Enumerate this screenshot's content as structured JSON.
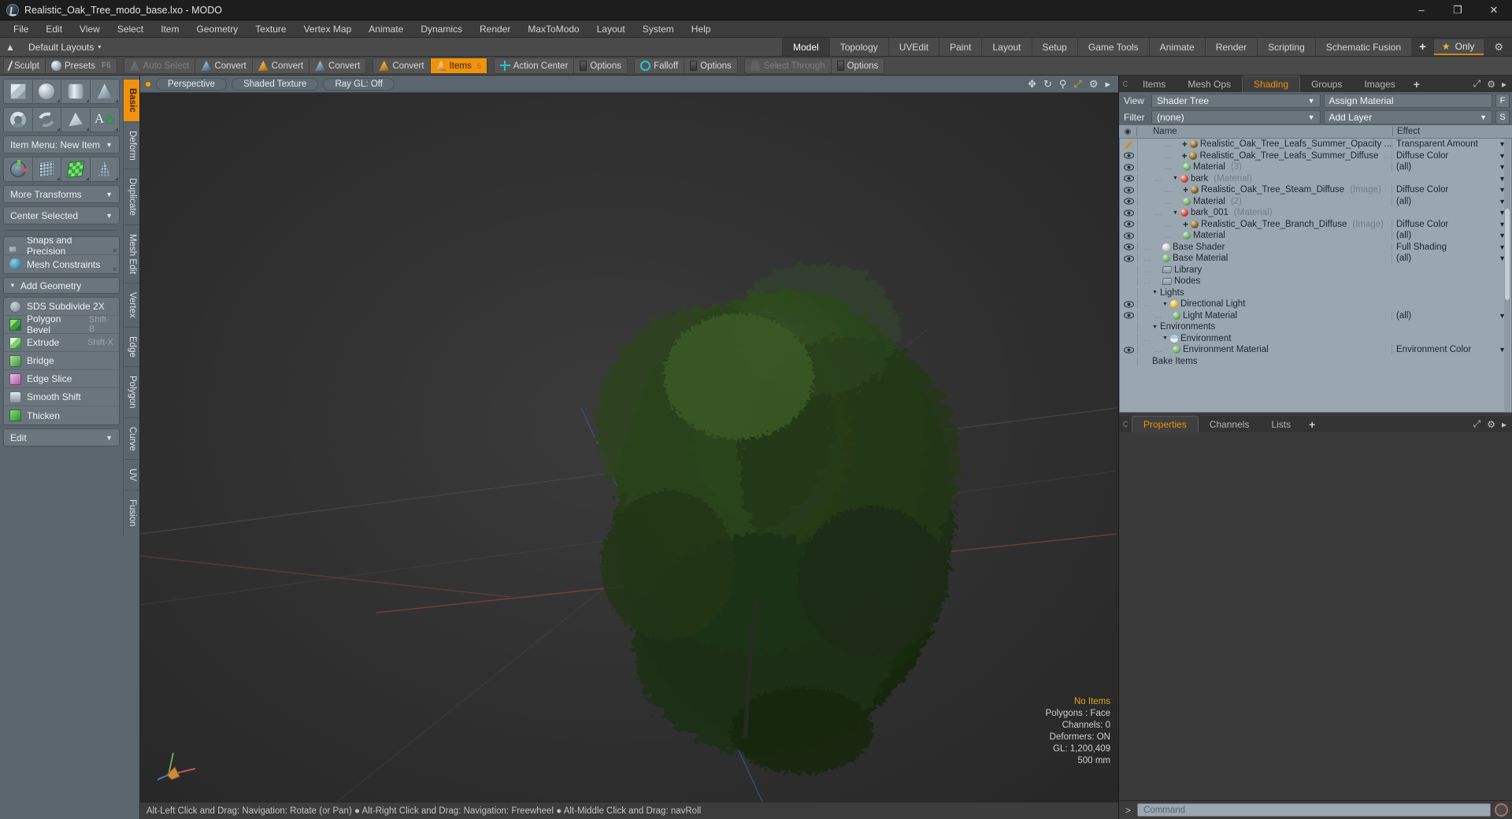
{
  "window": {
    "title": "Realistic_Oak_Tree_modo_base.lxo - MODO",
    "app_icon": "modo-logo-icon",
    "minimize": "–",
    "maximize": "❐",
    "close": "✕"
  },
  "menubar": {
    "items": [
      "File",
      "Edit",
      "View",
      "Select",
      "Item",
      "Geometry",
      "Texture",
      "Vertex Map",
      "Animate",
      "Dynamics",
      "Render",
      "MaxToModo",
      "Layout",
      "System",
      "Help"
    ]
  },
  "layoutbar": {
    "home_icon": "home-anchor-icon",
    "default_layouts": "Default Layouts",
    "caret": "▾",
    "tabs": [
      "Model",
      "Topology",
      "UVEdit",
      "Paint",
      "Layout",
      "Setup",
      "Game Tools",
      "Animate",
      "Render",
      "Scripting",
      "Schematic Fusion"
    ],
    "active_tab": "Model",
    "add_tab": "+",
    "only_label": "Only",
    "star": "★",
    "gear": "⚙"
  },
  "modebar": {
    "groups": [
      {
        "buttons": [
          {
            "label": "Sculpt",
            "icon": "sculpt-icon",
            "state": "normal"
          },
          {
            "label": "Presets",
            "icon": "presets-icon",
            "state": "normal",
            "shortcut": "F6"
          }
        ]
      },
      {
        "buttons": [
          {
            "label": "Auto Select",
            "icon": "auto-select-icon",
            "state": "dim"
          },
          {
            "label": "Convert",
            "icon": "convert-vertex-icon",
            "state": "normal"
          },
          {
            "label": "Convert",
            "icon": "convert-edge-icon",
            "state": "normal"
          },
          {
            "label": "Convert",
            "icon": "convert-polygon-icon",
            "state": "normal"
          }
        ]
      },
      {
        "buttons": [
          {
            "label": "Convert",
            "icon": "convert-item-icon",
            "state": "normal"
          },
          {
            "label": "Items",
            "icon": "items-icon",
            "state": "active",
            "badge": "5"
          }
        ]
      },
      {
        "buttons": [
          {
            "label": "Action Center",
            "icon": "action-center-icon",
            "state": "normal"
          },
          {
            "label": "Options",
            "icon": "options-icon",
            "state": "normal"
          }
        ]
      },
      {
        "buttons": [
          {
            "label": "Falloff",
            "icon": "falloff-icon",
            "state": "normal"
          },
          {
            "label": "Options",
            "icon": "options-icon",
            "state": "normal"
          }
        ]
      },
      {
        "buttons": [
          {
            "label": "Select Through",
            "icon": "select-through-icon",
            "state": "dim"
          },
          {
            "label": "Options",
            "icon": "options-icon",
            "state": "normal"
          }
        ]
      }
    ]
  },
  "leftpanel": {
    "primitives_row1": [
      {
        "name": "cube-tool",
        "icon": "cube-icon"
      },
      {
        "name": "sphere-tool",
        "icon": "sphere-icon"
      },
      {
        "name": "cylinder-tool",
        "icon": "cylinder-icon"
      },
      {
        "name": "cone-tool",
        "icon": "cone-icon"
      }
    ],
    "primitives_row2": [
      {
        "name": "torus-tool",
        "icon": "torus-icon"
      },
      {
        "name": "curve-tool",
        "icon": "curve-icon"
      },
      {
        "name": "polygon-tool",
        "icon": "polygon-icon"
      },
      {
        "name": "text-tool",
        "icon": "text-icon"
      }
    ],
    "item_menu": "Item Menu: New Item",
    "transforms_row": [
      {
        "name": "transform-tool",
        "icon": "transform-axis-icon"
      },
      {
        "name": "bend-tool",
        "icon": "grid-mesh-icon"
      },
      {
        "name": "twist-tool",
        "icon": "green-mesh-icon"
      },
      {
        "name": "taper-tool",
        "icon": "taper-icon"
      }
    ],
    "more_transforms": "More Transforms",
    "center_selected": "Center Selected",
    "snaps": "Snaps and Precision",
    "mesh_constraints": "Mesh Constraints",
    "add_geometry": "Add Geometry",
    "geometry_ops": [
      {
        "label": "SDS Subdivide 2X",
        "shortcut": "",
        "icon": "sds-subdivide-icon"
      },
      {
        "label": "Polygon Bevel",
        "shortcut": "Shift-B",
        "icon": "polygon-bevel-icon"
      },
      {
        "label": "Extrude",
        "shortcut": "Shift-X",
        "icon": "extrude-icon"
      },
      {
        "label": "Bridge",
        "shortcut": "",
        "icon": "bridge-icon"
      },
      {
        "label": "Edge Slice",
        "shortcut": "",
        "icon": "edge-slice-icon"
      },
      {
        "label": "Smooth Shift",
        "shortcut": "",
        "icon": "smooth-shift-icon"
      },
      {
        "label": "Thicken",
        "shortcut": "",
        "icon": "thicken-icon"
      }
    ],
    "edit_dropdown": "Edit",
    "vertical_tabs": [
      "Basic",
      "Deform",
      "Duplicate",
      "Mesh Edit",
      "Vertex",
      "Edge",
      "Polygon",
      "Curve",
      "UV",
      "Fusion"
    ],
    "vertical_active": "Basic"
  },
  "viewport": {
    "dot": "viewport-active-dot",
    "pills": [
      "Perspective",
      "Shaded Texture",
      "Ray GL: Off"
    ],
    "icons": [
      "move-icon",
      "rotate-icon",
      "zoom-icon",
      "fit-icon",
      "gear-icon",
      "chevron-right-icon"
    ],
    "stats": {
      "items": "No Items",
      "polygons": "Polygons : Face",
      "channels": "Channels: 0",
      "deformers": "Deformers: ON",
      "gl": "GL: 1,200,409",
      "scale": "500 mm"
    },
    "footer": "Alt-Left Click and Drag: Navigation: Rotate (or Pan) ● Alt-Right Click and Drag: Navigation: Freewheel ● Alt-Middle Click and Drag: navRoll",
    "gizmo_axes": [
      "x-axis-red",
      "y-axis-green",
      "z-axis-blue"
    ]
  },
  "rightpanel": {
    "top_tabs": [
      "Items",
      "Mesh Ops",
      "Shading",
      "Groups",
      "Images"
    ],
    "top_active": "Shading",
    "top_add": "+",
    "panel_icons": [
      "expand-icon",
      "gear-icon",
      "chevron-right-icon"
    ],
    "view_label": "View",
    "view_value": "Shader Tree",
    "assign_material": "Assign Material",
    "assign_btn": "F",
    "filter_label": "Filter",
    "filter_value": "(none)",
    "add_layer": "Add Layer",
    "add_layer_btn": "S",
    "tree_headers": {
      "eye": "◉",
      "name": "Name",
      "effect": "Effect"
    },
    "tree_rows": [
      {
        "indent": 4,
        "icon": "brush-icon",
        "vis": "brush",
        "expand": "+",
        "ball": "image",
        "name": "Realistic_Oak_Tree_Leafs_Summer_Opacity ...",
        "suffix": "",
        "effect": "Transparent Amount",
        "has_dropdown": true
      },
      {
        "indent": 4,
        "icon": "eye-icon",
        "vis": "eye",
        "expand": "+",
        "ball": "image",
        "name": "Realistic_Oak_Tree_Leafs_Summer_Diffuse",
        "suffix": "...",
        "effect": "Diffuse Color",
        "has_dropdown": true
      },
      {
        "indent": 4,
        "icon": "eye-icon",
        "vis": "eye",
        "expand": "",
        "ball": "green",
        "name": "Material",
        "suffix": "(3)",
        "effect": "(all)",
        "has_dropdown": true
      },
      {
        "indent": 3,
        "icon": "eye-icon",
        "vis": "eye",
        "expand": "▼",
        "ball": "red",
        "name": "bark",
        "suffix": "(Material)",
        "effect": "",
        "has_dropdown": true
      },
      {
        "indent": 4,
        "icon": "eye-icon",
        "vis": "eye",
        "expand": "+",
        "ball": "image",
        "name": "Realistic_Oak_Tree_Steam_Diffuse",
        "suffix": "(Image)",
        "effect": "Diffuse Color",
        "has_dropdown": true
      },
      {
        "indent": 4,
        "icon": "eye-icon",
        "vis": "eye",
        "expand": "",
        "ball": "green",
        "name": "Material",
        "suffix": "(2)",
        "effect": "(all)",
        "has_dropdown": true
      },
      {
        "indent": 3,
        "icon": "eye-icon",
        "vis": "eye",
        "expand": "▼",
        "ball": "red",
        "name": "bark_001",
        "suffix": "(Material)",
        "effect": "",
        "has_dropdown": true
      },
      {
        "indent": 4,
        "icon": "eye-icon",
        "vis": "eye",
        "expand": "+",
        "ball": "image",
        "name": "Realistic_Oak_Tree_Branch_Diffuse",
        "suffix": "(Image)",
        "effect": "Diffuse Color",
        "has_dropdown": true
      },
      {
        "indent": 4,
        "icon": "eye-icon",
        "vis": "eye",
        "expand": "",
        "ball": "green",
        "name": "Material",
        "suffix": "",
        "effect": "(all)",
        "has_dropdown": true
      },
      {
        "indent": 2,
        "icon": "eye-icon",
        "vis": "eye",
        "expand": "",
        "ball": "white",
        "name": "Base Shader",
        "suffix": "",
        "effect": "Full Shading",
        "has_dropdown": true
      },
      {
        "indent": 2,
        "icon": "eye-icon",
        "vis": "eye",
        "expand": "",
        "ball": "green",
        "name": "Base Material",
        "suffix": "",
        "effect": "(all)",
        "has_dropdown": true
      },
      {
        "indent": 2,
        "icon": "",
        "vis": "none",
        "expand": "",
        "ball": "folder",
        "name": "Library",
        "suffix": "",
        "effect": "",
        "has_dropdown": false
      },
      {
        "indent": 2,
        "icon": "",
        "vis": "none",
        "expand": "",
        "ball": "folder",
        "name": "Nodes",
        "suffix": "",
        "effect": "",
        "has_dropdown": false
      },
      {
        "indent": 1,
        "icon": "",
        "vis": "none",
        "expand": "▼",
        "ball": "none",
        "name": "Lights",
        "suffix": "",
        "effect": "",
        "has_dropdown": false
      },
      {
        "indent": 2,
        "icon": "eye-icon",
        "vis": "eye",
        "expand": "▼",
        "ball": "light",
        "name": "Directional Light",
        "suffix": "",
        "effect": "",
        "has_dropdown": false
      },
      {
        "indent": 3,
        "icon": "eye-icon",
        "vis": "eye",
        "expand": "",
        "ball": "green",
        "name": "Light Material",
        "suffix": "",
        "effect": "(all)",
        "has_dropdown": true
      },
      {
        "indent": 1,
        "icon": "",
        "vis": "none",
        "expand": "▼",
        "ball": "none",
        "name": "Environments",
        "suffix": "",
        "effect": "",
        "has_dropdown": false
      },
      {
        "indent": 2,
        "icon": "",
        "vis": "none",
        "expand": "▼",
        "ball": "env",
        "name": "Environment",
        "suffix": "",
        "effect": "",
        "has_dropdown": false
      },
      {
        "indent": 3,
        "icon": "eye-icon",
        "vis": "eye",
        "expand": "",
        "ball": "green",
        "name": "Environment Material",
        "suffix": "",
        "effect": "Environment Color",
        "has_dropdown": true
      },
      {
        "indent": 1,
        "icon": "",
        "vis": "none",
        "expand": "",
        "ball": "none",
        "name": "Bake Items",
        "suffix": "",
        "effect": "",
        "has_dropdown": false
      }
    ],
    "bottom_tabs": [
      "Properties",
      "Channels",
      "Lists"
    ],
    "bottom_active": "Properties",
    "bottom_add": "+"
  },
  "commandbar": {
    "prompt": ">",
    "placeholder": "Command",
    "record_icon": "record-circle-icon"
  }
}
